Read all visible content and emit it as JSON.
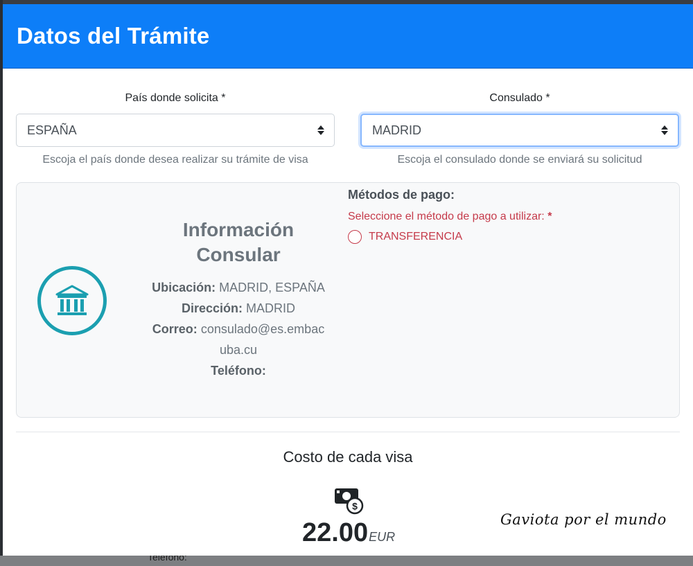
{
  "modal": {
    "title": "Datos del Trámite"
  },
  "country_field": {
    "label": "País donde solicita *",
    "value": "ESPAÑA",
    "help": "Escoja el país donde desea realizar su trámite de visa"
  },
  "consulate_field": {
    "label": "Consulado *",
    "value": "MADRID",
    "help": "Escoja el consulado donde se enviará su solicitud"
  },
  "consular_info": {
    "title_line1": "Información",
    "title_line2": "Consular",
    "location_label": "Ubicación:",
    "location_value": "MADRID, ESPAÑA",
    "address_label": "Dirección:",
    "address_value": "MADRID",
    "email_label": "Correo:",
    "email_value_line1": "consulado@es.embac",
    "email_value_line2": "uba.cu",
    "phone_label": "Teléfono:"
  },
  "payment": {
    "title": "Métodos de pago:",
    "note": "Seleccione el método de pago a utilizar:",
    "note_required": "*",
    "options": [
      {
        "label": "TRANSFERENCIA"
      }
    ]
  },
  "cost": {
    "title": "Costo de cada visa",
    "amount": "22.00",
    "currency": "EUR"
  },
  "watermark": {
    "text": "Gaviota por el mundo"
  },
  "backdrop": {
    "partial_text": "Teléfono:"
  },
  "colors": {
    "header_bg": "#0d7ef8",
    "accent_teal": "#1b9fb0",
    "danger": "#c53a4a"
  },
  "icons": {
    "bank": "bank-building-icon",
    "money": "money-bill-dollar-icon",
    "select_caret": "sort-caret-icon"
  }
}
